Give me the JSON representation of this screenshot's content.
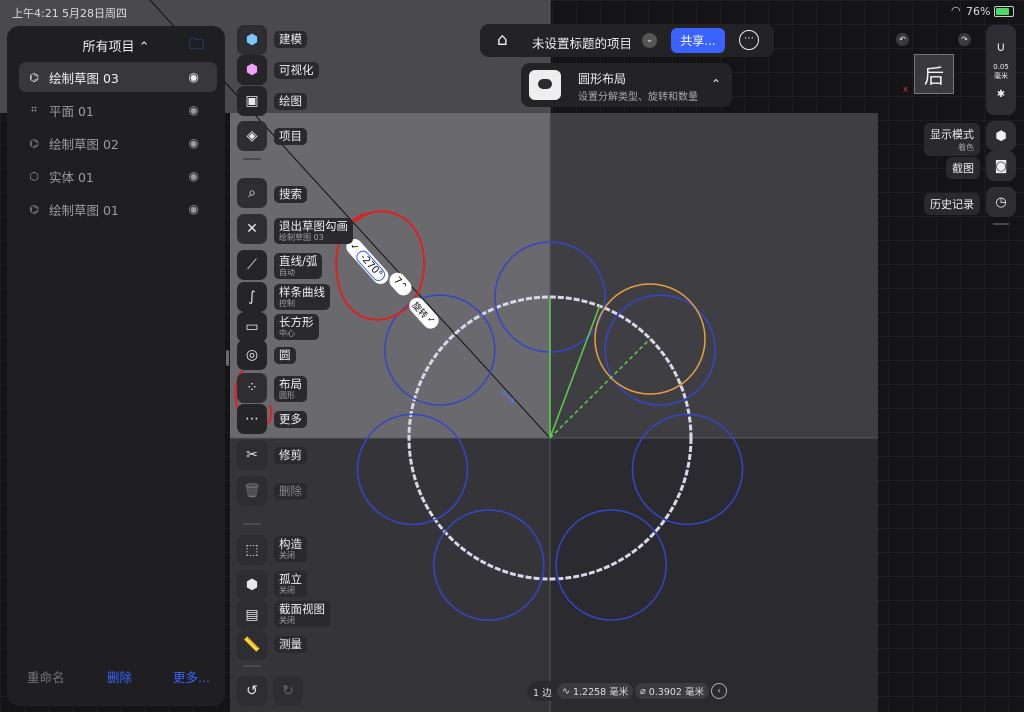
{
  "status_bar": {
    "time": "上午4:21",
    "date": "5月28日周四",
    "battery": "76%"
  },
  "panel": {
    "title": "所有项目",
    "items": [
      {
        "label": "绘制草图 03",
        "icon": "sketch-icon",
        "selected": true
      },
      {
        "label": "平面  01",
        "icon": "plane-icon",
        "selected": false
      },
      {
        "label": "绘制草图 02",
        "icon": "sketch-icon",
        "selected": false
      },
      {
        "label": "实体  01",
        "icon": "solid-icon",
        "selected": false
      },
      {
        "label": "绘制草图 01",
        "icon": "sketch-icon",
        "selected": false
      }
    ],
    "footer": {
      "rename": "重命名",
      "delete": "删除",
      "more": "更多..."
    }
  },
  "tools": {
    "modeling": "建模",
    "visualize": "可视化",
    "drawing": "绘图",
    "project": "项目",
    "search": "搜索",
    "exit_sketch": "退出草图勾画",
    "exit_sketch_sub": "绘制草图 03",
    "line_arc": "直线/弧",
    "line_arc_sub": "自动",
    "spline": "样条曲线",
    "spline_sub": "控制",
    "rectangle": "长方形",
    "rectangle_sub": "中心",
    "circle": "圆",
    "layout": "布局",
    "layout_sub": "圆形",
    "more": "更多",
    "trim": "修剪",
    "delete": "删除",
    "construct": "构造",
    "construct_sub": "关闭",
    "isolate": "孤立",
    "isolate_sub": "关闭",
    "section": "截面视图",
    "section_sub": "关闭",
    "measure": "测量"
  },
  "header": {
    "project_title": "未设置标题的项目",
    "share": "共享..."
  },
  "tooltip": {
    "title": "圆形布局",
    "subtitle": "设置分解类型、旋转和数量"
  },
  "right": {
    "view_cube_label": "后",
    "snap_value": "0.05",
    "snap_unit": "毫米",
    "display_mode": "显示模式",
    "display_mode_sub": "着色",
    "screenshot": "截图",
    "history": "历史记录"
  },
  "canvas_labels": {
    "angle": "-270°",
    "count": "7",
    "rotate": "旋转"
  },
  "bottom_bar": {
    "edges": "1 边",
    "length": "1.2258 毫米",
    "diameter": "0.3902 毫米"
  },
  "layout_geometry_count": 7
}
